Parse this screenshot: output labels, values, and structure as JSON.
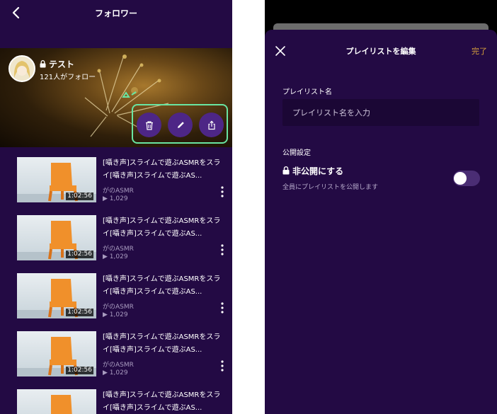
{
  "left_screen": {
    "header": {
      "title": "フォロワー"
    },
    "playlist": {
      "name": "テスト",
      "followers": "121人がフォロー"
    },
    "videos": [
      {
        "title": "[囁き声]スライムで遊ぶASMRをスライ[囁き声]スライムで遊ぶAS...",
        "duration": "1:02:56",
        "channel": "がのASMR",
        "views": "1,029"
      },
      {
        "title": "[囁き声]スライムで遊ぶASMRをスライ[囁き声]スライムで遊ぶAS...",
        "duration": "1:02:56",
        "channel": "がのASMR",
        "views": "1,029"
      },
      {
        "title": "[囁き声]スライムで遊ぶASMRをスライ[囁き声]スライムで遊ぶAS...",
        "duration": "1:02:56",
        "channel": "がのASMR",
        "views": "1,029"
      },
      {
        "title": "[囁き声]スライムで遊ぶASMRをスライ[囁き声]スライムで遊ぶAS...",
        "duration": "1:02:56",
        "channel": "がのASMR",
        "views": "1,029"
      },
      {
        "title": "[囁き声]スライムで遊ぶASMRをスライ[囁き声]スライムで遊ぶAS...",
        "duration": "",
        "channel": "",
        "views": ""
      }
    ]
  },
  "right_screen": {
    "header": {
      "title": "プレイリストを編集",
      "done_label": "完了"
    },
    "name_field": {
      "label": "プレイリスト名",
      "value": "",
      "placeholder": "プレイリスト名を入力"
    },
    "visibility": {
      "section_label": "公開設定",
      "option_label": "非公開にする",
      "option_description": "全員にプレイリストを公開します",
      "enabled": false
    }
  },
  "colors": {
    "background": "#230a44",
    "accent_done": "#d8a23c",
    "highlight_border": "#69e5a2",
    "action_button": "#4d2686"
  }
}
